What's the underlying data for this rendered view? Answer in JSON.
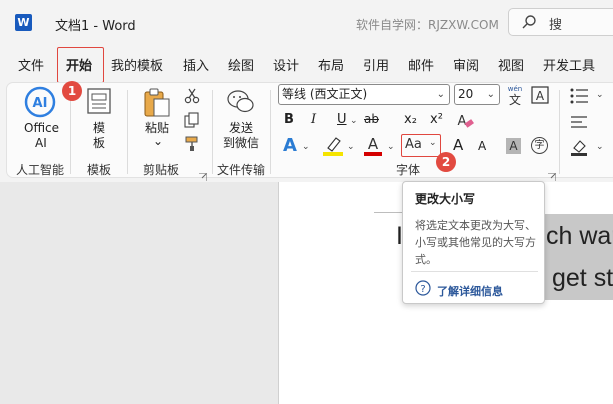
{
  "titlebar": {
    "app_letter": "W",
    "document_title": "文档1  -  Word",
    "watermark": "软件自学网：RJZXW.COM",
    "search_label": "搜"
  },
  "menu": {
    "items": [
      "文件",
      "开始",
      "我的模板",
      "插入",
      "绘图",
      "设计",
      "布局",
      "引用",
      "邮件",
      "审阅",
      "视图",
      "开发工具"
    ],
    "active": "开始"
  },
  "badges": {
    "first": "1",
    "second": "2"
  },
  "ribbon": {
    "office_ai": {
      "icon_text": "AI",
      "label_line1": "Office",
      "label_line2": "AI",
      "group": "人工智能"
    },
    "template": {
      "label_line1": "模",
      "label_line2": "板",
      "group": "模板"
    },
    "clipboard": {
      "paste_label": "粘贴",
      "paste_caret": "⌄",
      "group": "剪贴板"
    },
    "file_transfer": {
      "label_line1": "发送",
      "label_line2": "到微信",
      "group": "文件传输"
    },
    "font": {
      "font_name": "等线 (西文正文)",
      "font_size": "20",
      "wen_label": "wén\n文",
      "bold": "B",
      "italic": "I",
      "underline": "U",
      "strike": "ab",
      "subscript": "x₂",
      "superscript": "x²",
      "text_effect": "A",
      "highlight": "ab",
      "font_color": "A",
      "change_case": "Aa",
      "grow": "A",
      "shrink": "A",
      "char_shade": "A",
      "enclose": "字",
      "group": "字体",
      "highlight_color": "#f5e400",
      "font_color_value": "#d40000"
    }
  },
  "document": {
    "line1_start": "I",
    "line1_end": "ch war",
    "line2_end": "get st"
  },
  "tooltip": {
    "title": "更改大小写",
    "description": "将选定文本更改为大写、小写或其他常见的大写方式。",
    "link": "了解详细信息"
  },
  "colors": {
    "accent": "#2b579a",
    "badge": "#e24a40",
    "highlight_box": "#e0473f"
  }
}
